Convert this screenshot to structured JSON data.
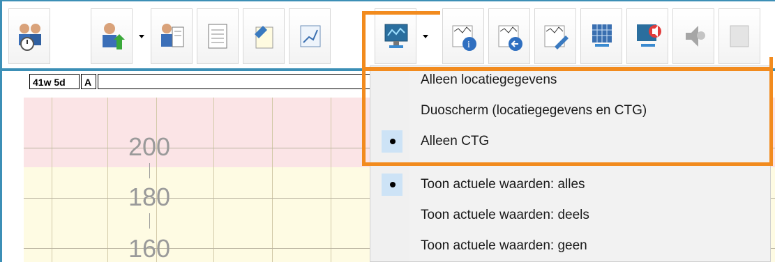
{
  "colors": {
    "frame_blue": "#3c8fb6",
    "highlight_orange": "#f28b1e",
    "zone_pink": "#fbe4e6",
    "zone_yellow": "#fefbe3",
    "menu_check_bg": "#cde3f6"
  },
  "toolbar": {
    "buttons": [
      {
        "icon": "patients-clock-icon"
      },
      {
        "icon": "user-arrow-icon",
        "has_dropdown": true
      },
      {
        "icon": "patient-document-icon"
      },
      {
        "icon": "notes-list-icon"
      },
      {
        "icon": "edit-document-icon"
      },
      {
        "icon": "chart-check-icon"
      },
      {
        "icon": "monitor-display-icon",
        "has_dropdown": true
      },
      {
        "icon": "ctg-info-icon"
      },
      {
        "icon": "ctg-back-icon"
      },
      {
        "icon": "ctg-edit-icon"
      },
      {
        "icon": "grid-monitor-icon"
      },
      {
        "icon": "monitor-alarm-icon"
      },
      {
        "icon": "speaker-muted-icon"
      },
      {
        "icon": "extra-disabled-icon"
      }
    ]
  },
  "ctg": {
    "gestation": "41w 5d",
    "marker": "A",
    "input_value": "",
    "y_ticks": [
      "200",
      "180",
      "160"
    ]
  },
  "menu": {
    "group1": [
      {
        "label": "Alleen locatiegegevens",
        "checked": false
      },
      {
        "label": "Duoscherm (locatiegegevens en CTG)",
        "checked": false
      },
      {
        "label": "Alleen CTG",
        "checked": true
      }
    ],
    "group2": [
      {
        "label": "Toon actuele waarden: alles",
        "checked": true
      },
      {
        "label": "Toon actuele waarden: deels",
        "checked": false
      },
      {
        "label": "Toon actuele waarden: geen",
        "checked": false
      }
    ]
  }
}
